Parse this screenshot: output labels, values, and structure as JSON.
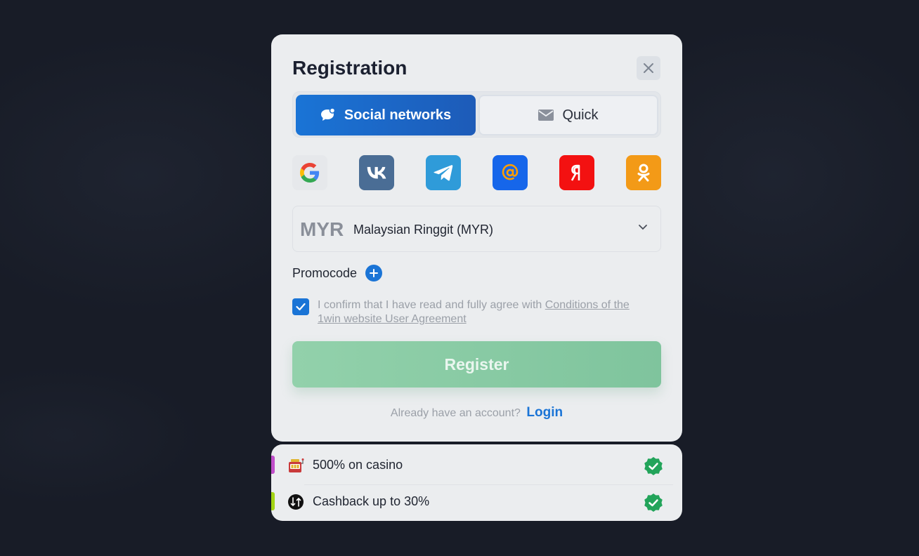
{
  "modal": {
    "title": "Registration",
    "tabs": [
      {
        "label": "Social networks",
        "icon": "chat-bubble-icon",
        "active": true
      },
      {
        "label": "Quick",
        "icon": "envelope-icon",
        "active": false
      }
    ],
    "social": [
      {
        "name": "google",
        "color": "#e6e8eb"
      },
      {
        "name": "vk",
        "color": "#4a6d95"
      },
      {
        "name": "telegram",
        "color": "#2f9bd9"
      },
      {
        "name": "mail-ru",
        "color": "#1666ea"
      },
      {
        "name": "yandex",
        "color": "#f31111"
      },
      {
        "name": "odnoklassniki",
        "color": "#f39a17"
      }
    ],
    "currency": {
      "code": "MYR",
      "name": "Malaysian Ringgit (MYR)"
    },
    "promocode_label": "Promocode",
    "agreement": {
      "checked": true,
      "text": "I confirm that I have read and fully agree with ",
      "link": "Conditions of the 1win website User Agreement"
    },
    "register_label": "Register",
    "login_prompt": "Already have an account?",
    "login_link": "Login"
  },
  "bonuses": [
    {
      "text": "500% on casino",
      "icon": "slot-machine-icon",
      "bar_color": "#c04ec9"
    },
    {
      "text": "Cashback up to 30%",
      "icon": "cashback-icon",
      "bar_color": "#a4d414"
    }
  ],
  "colors": {
    "accent": "#1a74d6",
    "register": "#8ccda6",
    "verified": "#22a45a"
  }
}
